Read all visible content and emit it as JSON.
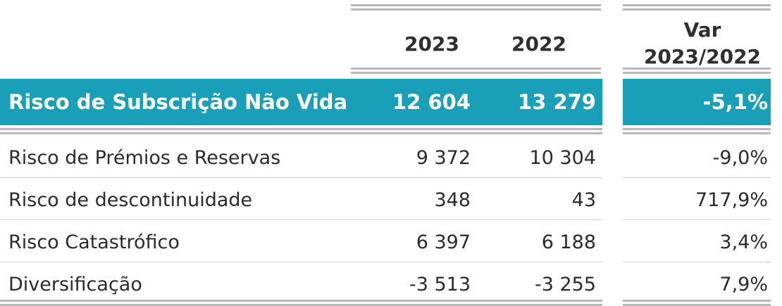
{
  "header": {
    "col_2023": "2023",
    "col_2022": "2022",
    "col_var_line1": "Var",
    "col_var_line2": "2023/2022"
  },
  "highlight": {
    "label": "Risco de Subscrição Não Vida",
    "v2023": "12 604",
    "v2022": "13 279",
    "var": "-5,1%",
    "color": "#1a9fb8"
  },
  "rows": [
    {
      "label": "Risco de Prémios e Reservas",
      "v2023": "9 372",
      "v2022": "10 304",
      "var": "-9,0%"
    },
    {
      "label": "Risco de descontinuidade",
      "v2023": "348",
      "v2022": "43",
      "var": "717,9%"
    },
    {
      "label": "Risco Catastrófico",
      "v2023": "6 397",
      "v2022": "6 188",
      "var": "3,4%"
    },
    {
      "label": "Diversificação",
      "v2023": "-3 513",
      "v2022": "-3 255",
      "var": "7,9%"
    }
  ]
}
